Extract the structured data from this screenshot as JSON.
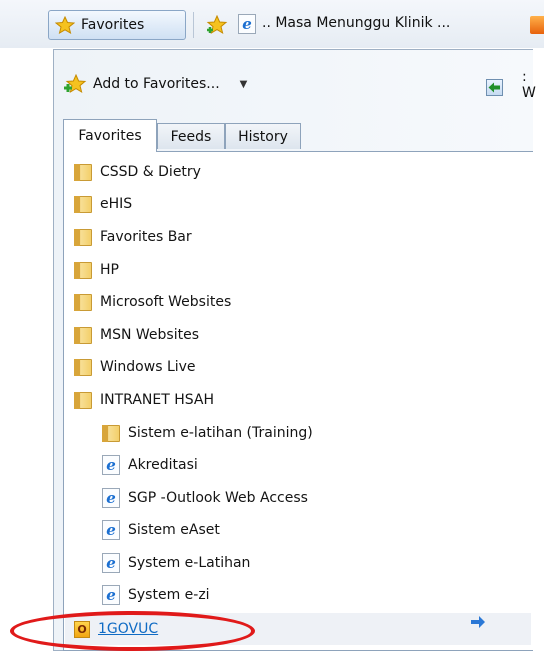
{
  "topbar": {
    "favorites_button": "Favorites",
    "tab_title": ".. Masa Menunggu Klinik ..."
  },
  "panel": {
    "add_to_favorites": "Add to Favorites...",
    "clipped_text": ": W",
    "tabs": [
      "Favorites",
      "Feeds",
      "History"
    ],
    "items": [
      {
        "label": "CSSD & Dietry",
        "icon": "folder-icon"
      },
      {
        "label": "eHIS",
        "icon": "folder-icon"
      },
      {
        "label": "Favorites Bar",
        "icon": "folder-icon"
      },
      {
        "label": "HP",
        "icon": "folder-icon"
      },
      {
        "label": "Microsoft Websites",
        "icon": "folder-icon"
      },
      {
        "label": "MSN Websites",
        "icon": "folder-icon"
      },
      {
        "label": "Windows Live",
        "icon": "folder-icon"
      },
      {
        "label": "INTRANET HSAH",
        "icon": "folder-icon"
      },
      {
        "label": "Sistem e-latihan (Training)",
        "icon": "folder-icon"
      },
      {
        "label": "Akreditasi",
        "icon": "ie-page-icon"
      },
      {
        "label": "SGP -Outlook Web Access",
        "icon": "ie-page-icon"
      },
      {
        "label": "Sistem  eAset",
        "icon": "ie-page-icon"
      },
      {
        "label": "System  e-Latihan",
        "icon": "ie-page-icon"
      },
      {
        "label": "System  e-zi",
        "icon": "ie-page-icon"
      },
      {
        "label": "1GOVUC",
        "icon": "outlook-icon"
      }
    ]
  },
  "colors": {
    "highlight_oval": "#e01a1a",
    "link": "#0f6bc4"
  }
}
